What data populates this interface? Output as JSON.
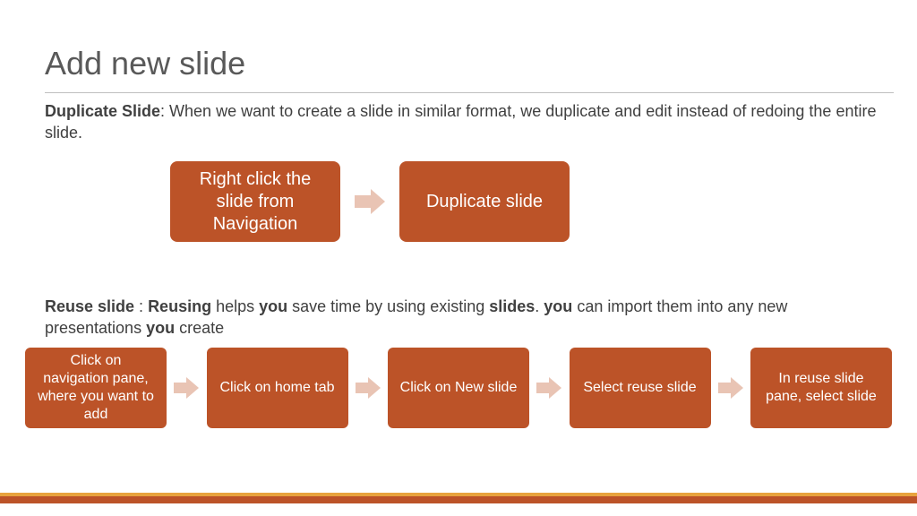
{
  "title": "Add new slide",
  "section1": {
    "label": "Duplicate Slide",
    "desc": ": When we want to create a slide in similar format, we duplicate and edit instead of redoing the entire slide."
  },
  "flow1": {
    "steps": [
      "Right click the slide from Navigation",
      "Duplicate slide"
    ]
  },
  "section2": {
    "parts": [
      {
        "b": true,
        "t": "Reuse slide"
      },
      {
        "b": false,
        "t": " : "
      },
      {
        "b": true,
        "t": "Reusing"
      },
      {
        "b": false,
        "t": " helps "
      },
      {
        "b": true,
        "t": "you"
      },
      {
        "b": false,
        "t": " save time by using existing "
      },
      {
        "b": true,
        "t": "slides"
      },
      {
        "b": false,
        "t": ". "
      },
      {
        "b": true,
        "t": "you"
      },
      {
        "b": false,
        "t": " can import them into any new presentations "
      },
      {
        "b": true,
        "t": "you"
      },
      {
        "b": false,
        "t": " create"
      }
    ]
  },
  "flow2": {
    "steps": [
      "Click on navigation pane, where you want to add",
      "Click on home tab",
      "Click on New slide",
      "Select reuse slide",
      "In reuse slide pane, select slide"
    ]
  }
}
